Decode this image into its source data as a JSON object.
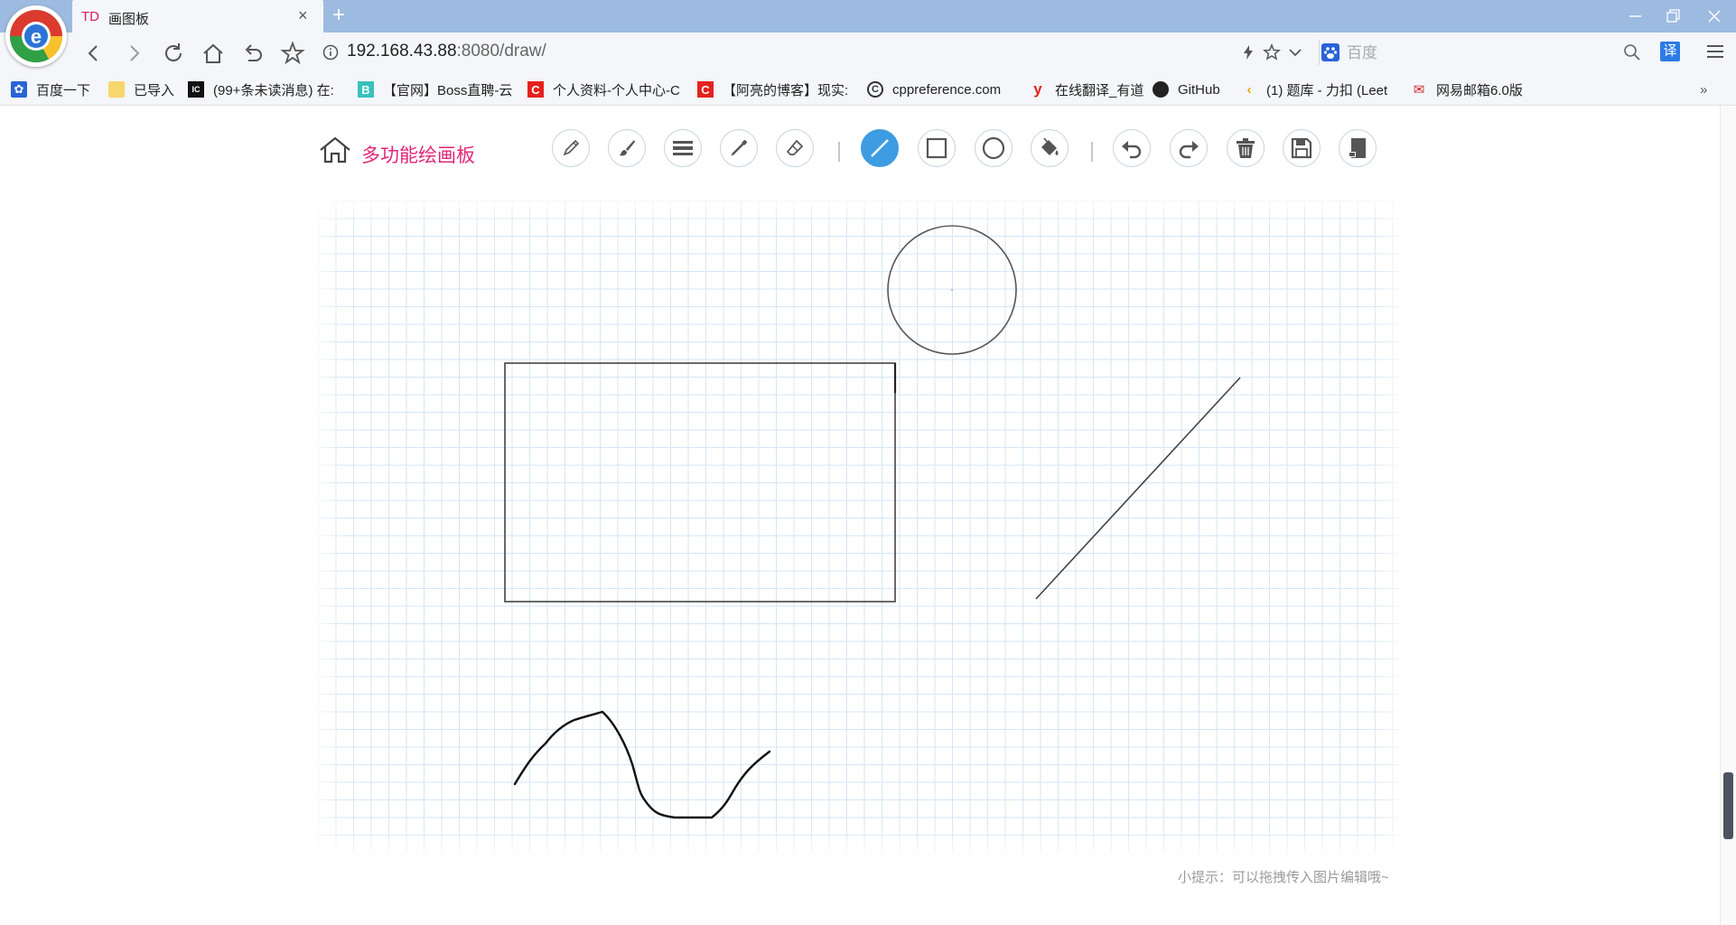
{
  "browser": {
    "tab": {
      "prefix": "TD",
      "title": "画图板",
      "close": "×"
    },
    "new_tab": "+",
    "address": {
      "host": "192.168.43.88",
      "rest": ":8080/draw/"
    },
    "search": {
      "placeholder": "百度"
    },
    "translate_label": "译",
    "bookmarks_more": "»",
    "bookmarks": [
      {
        "label": "百度一下",
        "icon": "baidu-paw-icon",
        "color": "#2a63d8",
        "glyph": ""
      },
      {
        "label": "已导入",
        "icon": "folder-icon",
        "color": "#f5d76e",
        "glyph": ""
      },
      {
        "label": "(99+条未读消息) 在:",
        "icon": "app-icon",
        "color": "#111111",
        "glyph": ""
      },
      {
        "label": "【官网】Boss直聘-云",
        "icon": "boss-b-icon",
        "color": "#37c2bb",
        "glyph": "B"
      },
      {
        "label": "个人资料-个人中心-C",
        "icon": "csdn-c-icon",
        "color": "#e5211d",
        "glyph": "C"
      },
      {
        "label": "【阿亮的博客】现实:",
        "icon": "csdn-c-icon",
        "color": "#e5211d",
        "glyph": "C"
      },
      {
        "label": "cppreference.com",
        "icon": "cppreference-icon",
        "color": "#333333",
        "glyph": "C"
      },
      {
        "label": "在线翻译_有道",
        "icon": "youdao-icon",
        "color": "#e5211d",
        "glyph": "y"
      },
      {
        "label": "GitHub",
        "icon": "github-icon",
        "color": "#222222",
        "glyph": ""
      },
      {
        "label": "(1) 题库 - 力扣 (Leet",
        "icon": "leetcode-icon",
        "color": "#f0a000",
        "glyph": ""
      },
      {
        "label": "网易邮箱6.0版",
        "icon": "netease-mail-icon",
        "color": "#d4202a",
        "glyph": ""
      }
    ]
  },
  "app": {
    "title": "多功能绘画板",
    "tools": [
      {
        "name": "pencil",
        "active": false
      },
      {
        "name": "brush",
        "active": false
      },
      {
        "name": "line-width",
        "active": false
      },
      {
        "name": "eyedropper",
        "active": false
      },
      {
        "name": "eraser",
        "active": false
      },
      {
        "name": "line",
        "active": true
      },
      {
        "name": "rectangle",
        "active": false
      },
      {
        "name": "circle",
        "active": false
      },
      {
        "name": "fill-bucket",
        "active": false
      },
      {
        "name": "undo",
        "active": false
      },
      {
        "name": "redo",
        "active": false
      },
      {
        "name": "clear-trash",
        "active": false
      },
      {
        "name": "save",
        "active": false
      },
      {
        "name": "download",
        "active": false
      }
    ],
    "tip": "小提示：可以拖拽传入图片编辑哦~"
  },
  "colors": {
    "accent": "#3d9ce2",
    "title_pink": "#e0267a",
    "chrome_blue": "#9dbbe0",
    "grid": "#d6e6f4",
    "stroke": "#444444"
  }
}
